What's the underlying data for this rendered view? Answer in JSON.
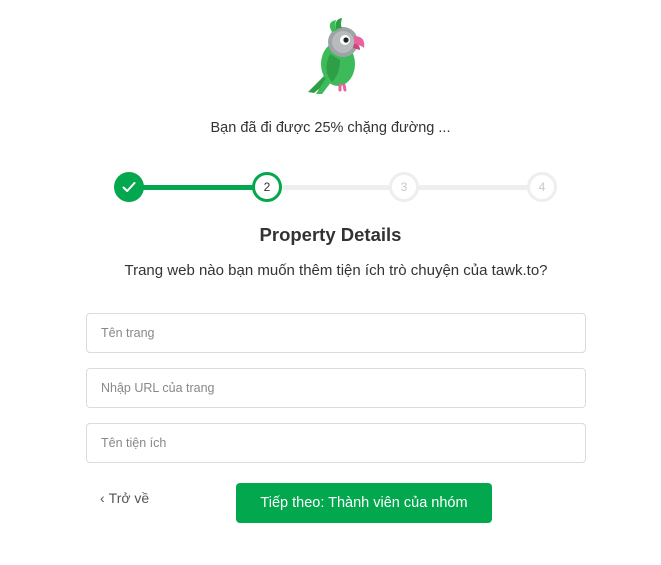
{
  "logo": {
    "icon": "tawk-parrot-logo",
    "primary_color": "#3dbb5a",
    "accent_color": "#e8639b"
  },
  "progress": {
    "text": "Bạn đã đi được 25% chặng đường ...",
    "percent": 25
  },
  "stepper": {
    "current_step": 2,
    "steps": [
      {
        "label": "",
        "state": "complete",
        "icon": "check-icon"
      },
      {
        "label": "2",
        "state": "current"
      },
      {
        "label": "3",
        "state": "pending"
      },
      {
        "label": "4",
        "state": "pending"
      }
    ],
    "colors": {
      "active": "#03a84e",
      "inactive": "#eeeeee"
    }
  },
  "heading": {
    "title": "Property Details",
    "subtitle": "Trang web nào bạn muốn thêm tiện ích trò chuyện của tawk.to?"
  },
  "form": {
    "site_name": {
      "value": "",
      "placeholder": "Tên trang"
    },
    "site_url": {
      "value": "",
      "placeholder": "Nhập URL của trang"
    },
    "widget_name": {
      "value": "",
      "placeholder": "Tên tiện ích"
    }
  },
  "actions": {
    "back_label": "Trở về",
    "next_label": "Tiếp theo: Thành viên của nhóm",
    "button_color": "#03a84e"
  }
}
